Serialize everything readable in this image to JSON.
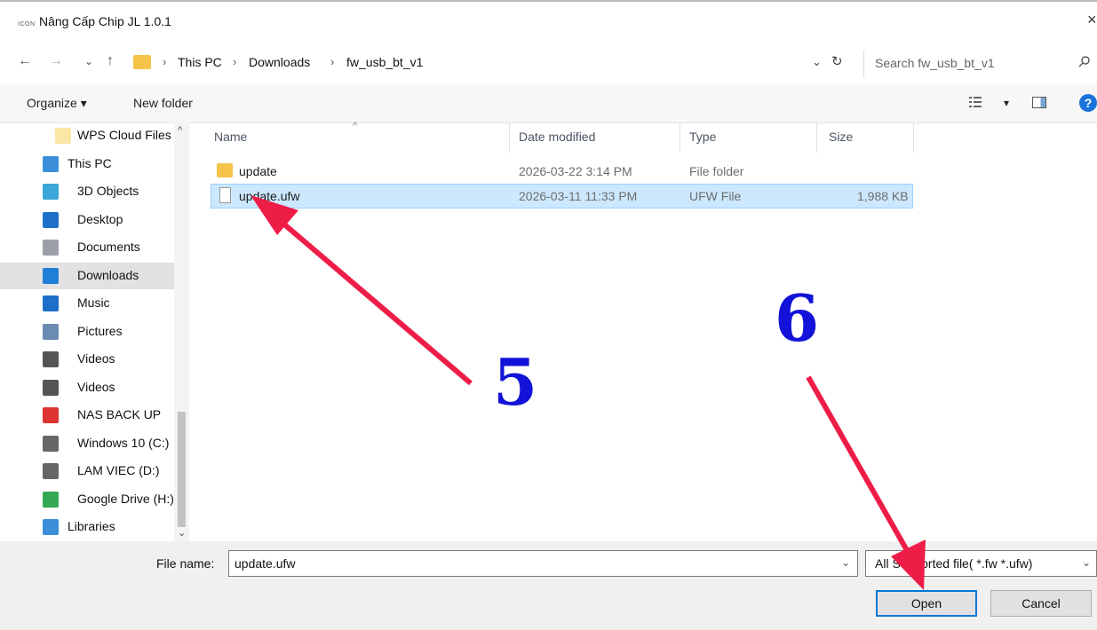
{
  "window": {
    "app_icon_text": "ICON",
    "title": "Nâng Cấp Chip JL 1.0.1",
    "close_glyph": "×"
  },
  "nav": {
    "back": "←",
    "forward": "→",
    "recent": "⌄",
    "up": "↑",
    "breadcrumbs": [
      "This PC",
      "Downloads",
      "fw_usb_bt_v1"
    ],
    "sep": "›",
    "dropdown": "⌄",
    "refresh": "↻",
    "search_placeholder": "Search fw_usb_bt_v1"
  },
  "toolbar": {
    "organize": "Organize ▾",
    "new_folder": "New folder",
    "view_dropdown": "▾",
    "help": "?"
  },
  "sidebar": {
    "items": [
      {
        "label": "WPS Cloud Files",
        "icon": "folder-icon"
      },
      {
        "label": "This PC",
        "icon": "computer-icon"
      },
      {
        "label": "3D Objects",
        "icon": "cube-icon"
      },
      {
        "label": "Desktop",
        "icon": "desktop-icon"
      },
      {
        "label": "Documents",
        "icon": "document-icon"
      },
      {
        "label": "Downloads",
        "icon": "download-icon",
        "selected": true
      },
      {
        "label": "Music",
        "icon": "music-icon"
      },
      {
        "label": "Pictures",
        "icon": "picture-icon"
      },
      {
        "label": "Videos",
        "icon": "video-icon"
      },
      {
        "label": "Videos",
        "icon": "video-icon"
      },
      {
        "label": "NAS BACK UP",
        "icon": "network-drive-icon"
      },
      {
        "label": "Windows 10 (C:)",
        "icon": "drive-icon"
      },
      {
        "label": "LAM VIEC (D:)",
        "icon": "drive-icon"
      },
      {
        "label": "Google Drive (H:)",
        "icon": "google-drive-icon"
      },
      {
        "label": "Libraries",
        "icon": "library-icon"
      }
    ],
    "scroll_up": "^",
    "scroll_down": "⌄"
  },
  "filelist": {
    "columns": {
      "name": "Name",
      "date": "Date modified",
      "type": "Type",
      "size": "Size"
    },
    "sort_indicator": "^",
    "rows": [
      {
        "name": "update",
        "date": "2026-03-22 3:14 PM",
        "type": "File folder",
        "size": "",
        "kind": "folder"
      },
      {
        "name": "update.ufw",
        "date": "2026-03-11 11:33 PM",
        "type": "UFW File",
        "size": "1,988 KB",
        "kind": "file",
        "selected": true
      }
    ]
  },
  "bottom": {
    "file_name_label": "File name:",
    "file_name_value": "update.ufw",
    "file_type_value": "All Supported file( *.fw *.ufw)",
    "open": "Open",
    "cancel": "Cancel",
    "dropdown": "⌄"
  },
  "annotations": {
    "step5": "5",
    "step6": "6",
    "arrow_color": "#ee1d48",
    "number_color": "#1212d8"
  }
}
